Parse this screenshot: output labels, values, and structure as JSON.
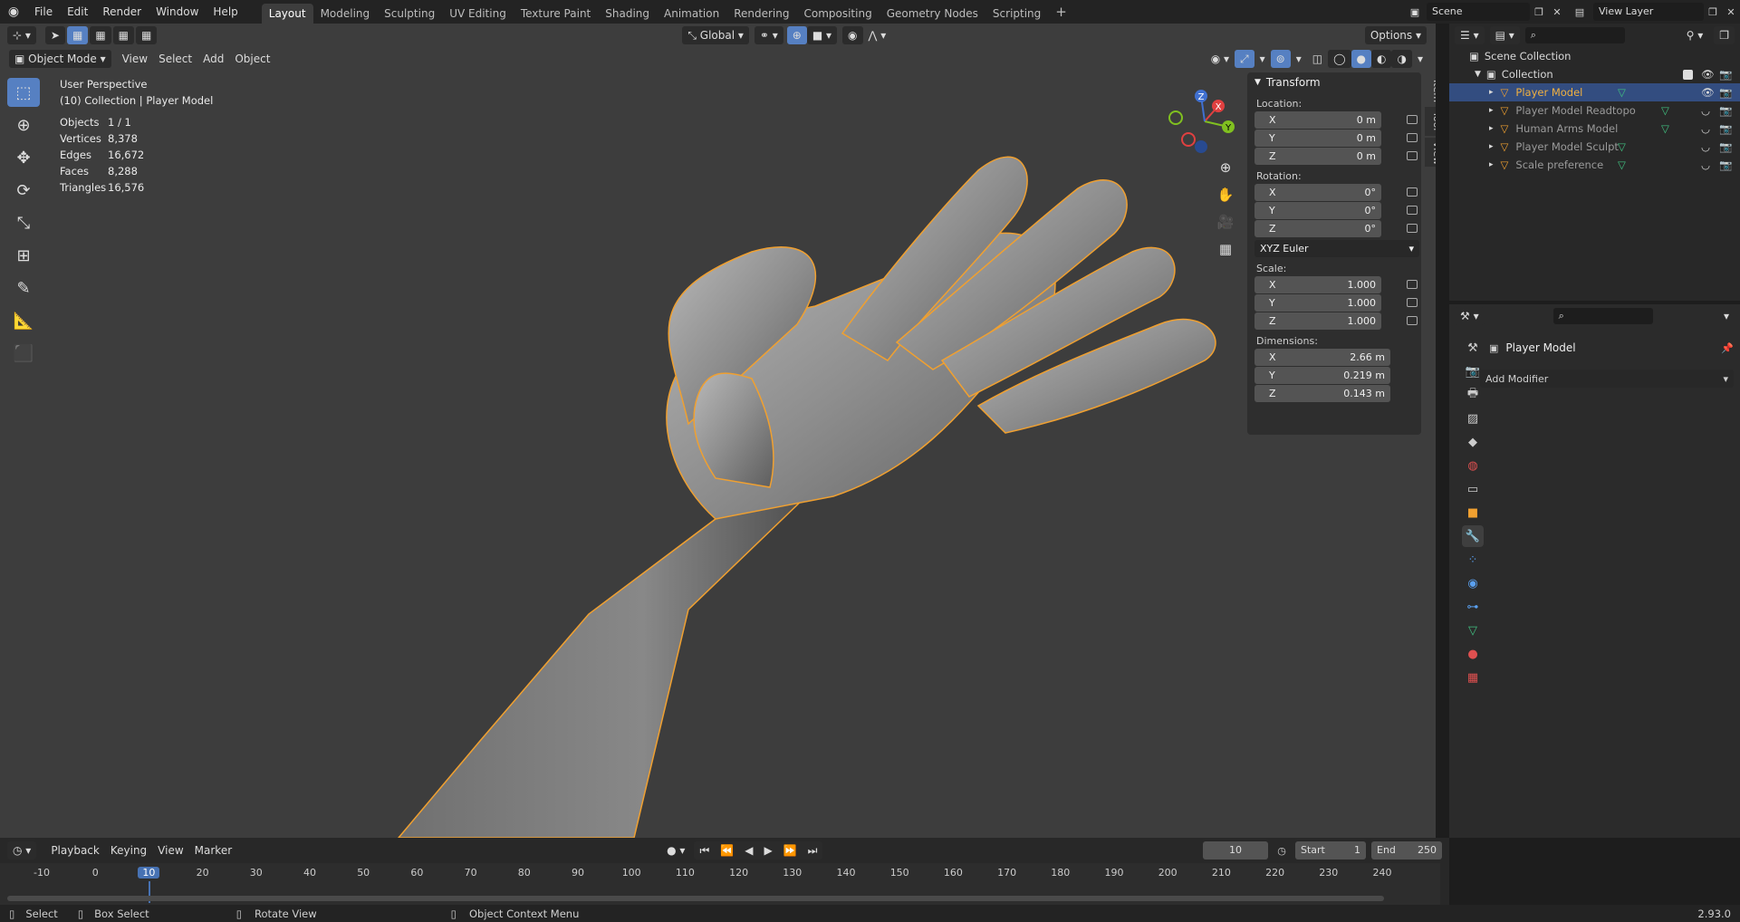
{
  "menu": [
    "File",
    "Edit",
    "Render",
    "Window",
    "Help"
  ],
  "workspaces": [
    "Layout",
    "Modeling",
    "Sculpting",
    "UV Editing",
    "Texture Paint",
    "Shading",
    "Animation",
    "Rendering",
    "Compositing",
    "Geometry Nodes",
    "Scripting"
  ],
  "active_workspace": "Layout",
  "plus": "+",
  "scene": "Scene",
  "view_layer": "View Layer",
  "viewport_header": {
    "mode": "Object Mode",
    "menus": [
      "View",
      "Select",
      "Add",
      "Object"
    ],
    "transform_orientation": "Global",
    "options": "Options"
  },
  "overlay_info": {
    "perspective": "User Perspective",
    "collection": "(10) Collection | Player Model"
  },
  "stats": [
    {
      "label": "Objects",
      "value": "1 / 1"
    },
    {
      "label": "Vertices",
      "value": "8,378"
    },
    {
      "label": "Edges",
      "value": "16,672"
    },
    {
      "label": "Faces",
      "value": "8,288"
    },
    {
      "label": "Triangles",
      "value": "16,576"
    }
  ],
  "gizmo": {
    "x": "X",
    "y": "Y",
    "z": "Z"
  },
  "transform": {
    "title": "Transform",
    "location_label": "Location:",
    "rotation_label": "Rotation:",
    "scale_label": "Scale:",
    "dimensions_label": "Dimensions:",
    "location": [
      {
        "axis": "X",
        "value": "0 m"
      },
      {
        "axis": "Y",
        "value": "0 m"
      },
      {
        "axis": "Z",
        "value": "0 m"
      }
    ],
    "rotation": [
      {
        "axis": "X",
        "value": "0°"
      },
      {
        "axis": "Y",
        "value": "0°"
      },
      {
        "axis": "Z",
        "value": "0°"
      }
    ],
    "rotation_mode": "XYZ Euler",
    "scale": [
      {
        "axis": "X",
        "value": "1.000"
      },
      {
        "axis": "Y",
        "value": "1.000"
      },
      {
        "axis": "Z",
        "value": "1.000"
      }
    ],
    "dimensions": [
      {
        "axis": "X",
        "value": "2.66 m"
      },
      {
        "axis": "Y",
        "value": "0.219 m"
      },
      {
        "axis": "Z",
        "value": "0.143 m"
      }
    ]
  },
  "side_tabs": [
    "Item",
    "Tool",
    "View"
  ],
  "outliner": {
    "scene_collection": "Scene Collection",
    "collection": "Collection",
    "items": [
      {
        "name": "Player Model",
        "selected": true
      },
      {
        "name": "Player Model Readtopo",
        "selected": false
      },
      {
        "name": "Human Arms Model",
        "selected": false
      },
      {
        "name": "Player Model Sculpt",
        "selected": false
      },
      {
        "name": "Scale preference",
        "selected": false
      }
    ]
  },
  "properties": {
    "object_name": "Player Model",
    "add_modifier": "Add Modifier"
  },
  "timeline": {
    "menus": [
      "Playback",
      "Keying",
      "View",
      "Marker"
    ],
    "current_frame": "10",
    "start_label": "Start",
    "start": "1",
    "end_label": "End",
    "end": "250",
    "ticks": [
      "-10",
      "0",
      "10",
      "20",
      "30",
      "40",
      "50",
      "60",
      "70",
      "80",
      "90",
      "100",
      "110",
      "120",
      "130",
      "140",
      "150",
      "160",
      "170",
      "180",
      "190",
      "200",
      "210",
      "220",
      "230",
      "240"
    ]
  },
  "statusbar": {
    "select": "Select",
    "box_select": "Box Select",
    "rotate_view": "Rotate View",
    "context_menu": "Object Context Menu",
    "version": "2.93.0"
  },
  "colors": {
    "accent": "#5680c2",
    "selection": "#f0a030",
    "outliner_selected": "#334d80"
  }
}
